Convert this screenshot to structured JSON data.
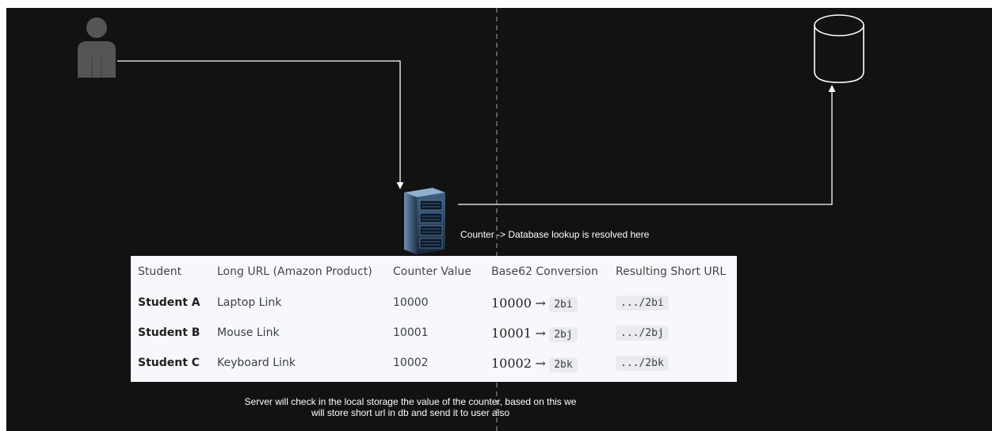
{
  "server_note": "Counter -> Database lookup is resolved here",
  "bottom_note": "Server will check in the local storage the value of the counter, based on this we will store short url in db and send it to user also",
  "table": {
    "headers": [
      "Student",
      "Long URL (Amazon Product)",
      "Counter Value",
      "Base62 Conversion",
      "Resulting Short URL"
    ],
    "rows": [
      {
        "student": "Student A",
        "long_url": "Laptop Link",
        "counter": "10000",
        "conv_from": "10000",
        "arrow": "→",
        "conv_to": "2bi",
        "short_url": ".../2bi"
      },
      {
        "student": "Student B",
        "long_url": "Mouse Link",
        "counter": "10001",
        "conv_from": "10001",
        "arrow": "→",
        "conv_to": "2bj",
        "short_url": ".../2bj"
      },
      {
        "student": "Student C",
        "long_url": "Keyboard Link",
        "counter": "10002",
        "conv_from": "10002",
        "arrow": "→",
        "conv_to": "2bk",
        "short_url": ".../2bk"
      }
    ]
  },
  "icons": {
    "user": "user-icon",
    "server": "server-rack-icon",
    "database": "database-cylinder-icon"
  },
  "colors": {
    "background": "#121212",
    "lines": "#ffffff",
    "table_background": "#f7f8fb",
    "user_icon": "#555555"
  }
}
